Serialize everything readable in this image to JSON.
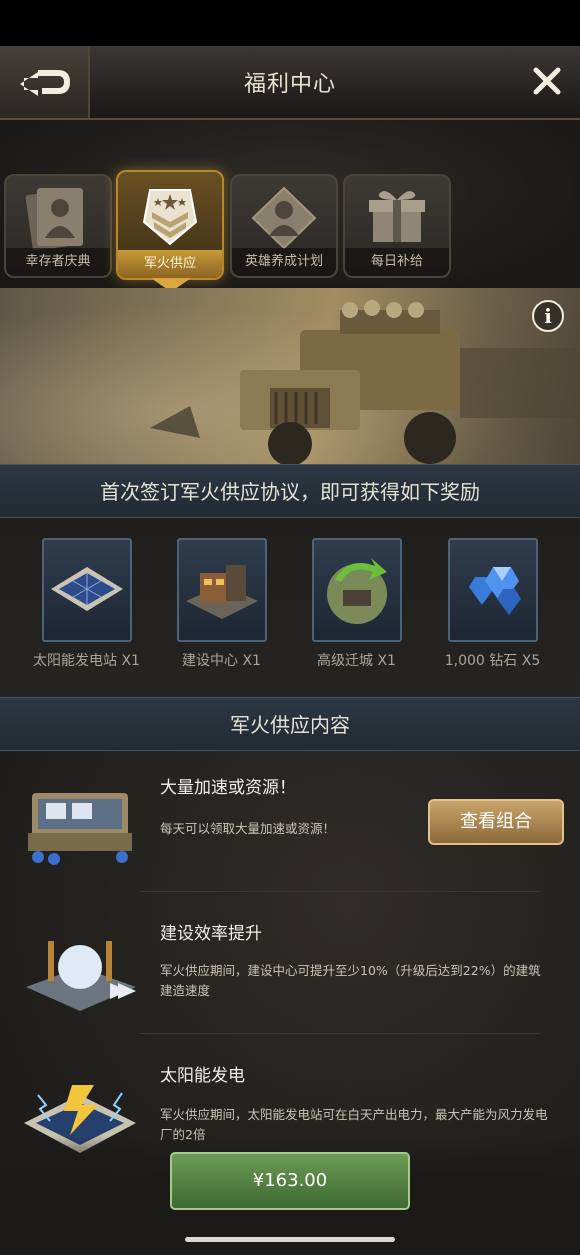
{
  "header": {
    "title": "福利中心"
  },
  "tabs": [
    {
      "label": "幸存者庆典",
      "icon": "survivor-card-icon",
      "active": false
    },
    {
      "label": "军火供应",
      "icon": "military-rank-icon",
      "active": true
    },
    {
      "label": "英雄养成计划",
      "icon": "hero-diamond-icon",
      "active": false
    },
    {
      "label": "每日补给",
      "icon": "gift-box-icon",
      "active": false
    }
  ],
  "banner": {
    "info": "i"
  },
  "first_sign": {
    "heading": "首次签订军火供应协议，即可获得如下奖励"
  },
  "rewards": [
    {
      "label": "太阳能发电站 X1",
      "icon": "solar-station-icon"
    },
    {
      "label": "建设中心 X1",
      "icon": "construction-center-icon"
    },
    {
      "label": "高级迁城 X1",
      "icon": "relocation-icon"
    },
    {
      "label": "1,000 钻石 X5",
      "icon": "diamond-icon"
    }
  ],
  "supply": {
    "heading": "军火供应内容",
    "items": [
      {
        "title": "大量加速或资源！",
        "desc": "每天可以领取大量加速或资源！",
        "icon": "resource-chest-icon"
      },
      {
        "title": "建设效率提升",
        "desc": "军火供应期间，建设中心可提升至少10%（升级后达到22%）的建筑建造速度",
        "icon": "construction-boost-icon"
      },
      {
        "title": "太阳能发电",
        "desc": "军火供应期间，太阳能发电站可在白天产出电力，最大产能为风力发电厂的2倍",
        "icon": "solar-power-icon"
      }
    ],
    "view_button": "查看组合"
  },
  "purchase": {
    "price": "¥163.00"
  },
  "colors": {
    "accent_gold": "#d9a640",
    "buy_green": "#4f8040",
    "section_blue": "#2a333d"
  }
}
